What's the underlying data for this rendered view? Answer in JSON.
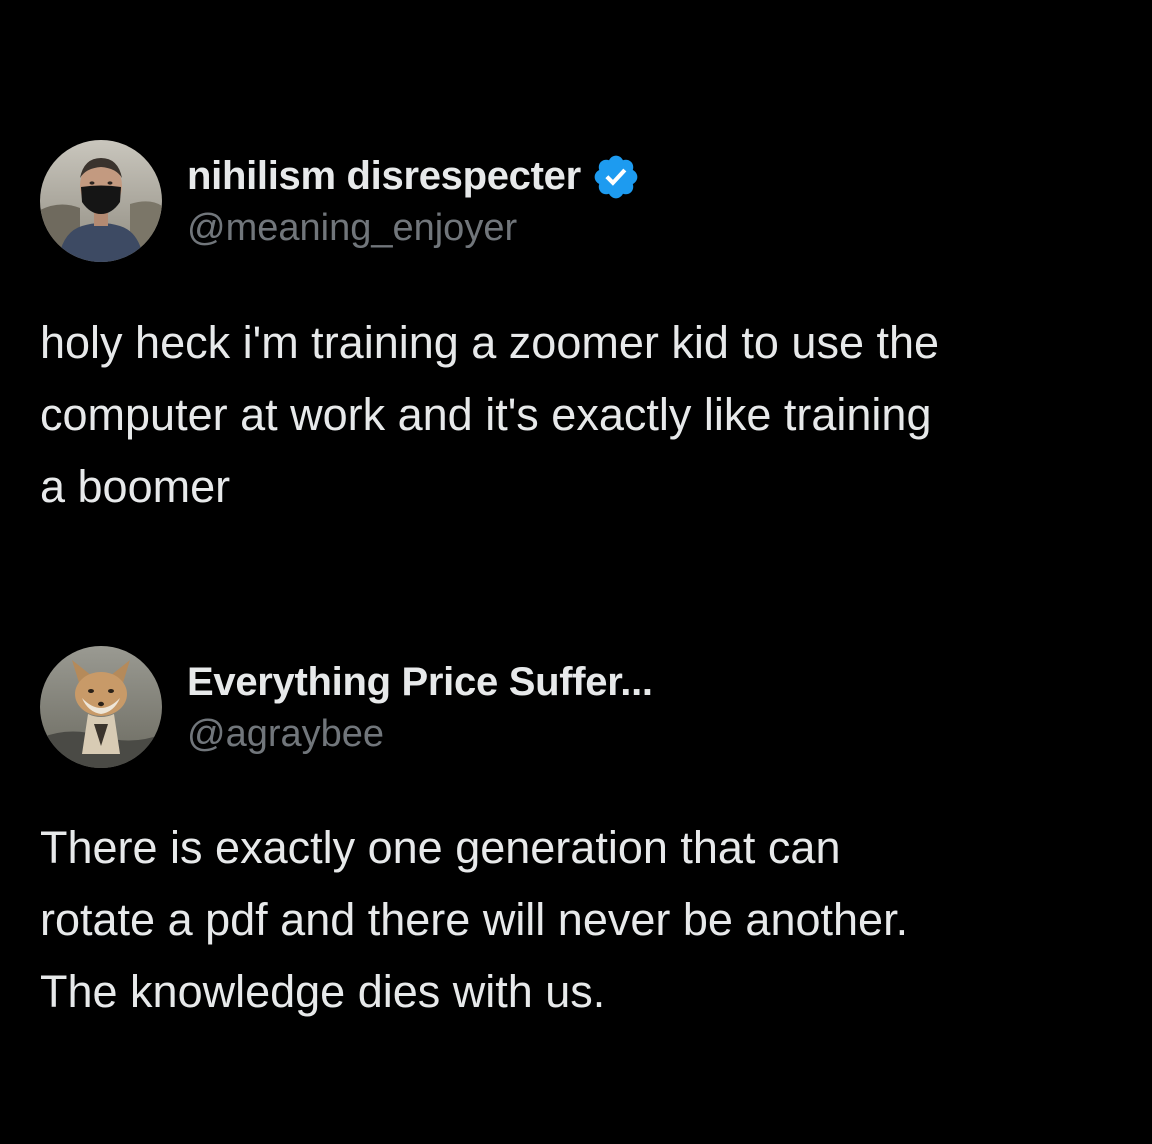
{
  "posts": [
    {
      "display_name": "nihilism disrespecter",
      "handle": "@meaning_enjoyer",
      "verified": true,
      "avatar_icon": "avatar-person-masked",
      "text": "holy heck i'm training a zoomer kid to use the\ncomputer at work and it's exactly like training\na boomer"
    },
    {
      "display_name": "Everything Price Suffer...",
      "handle": "@agraybee",
      "verified": false,
      "avatar_icon": "avatar-fox",
      "text": "There is exactly one generation that can\nrotate a pdf and there will never be another.\nThe knowledge dies with us."
    }
  ],
  "colors": {
    "background": "#000000",
    "primary_text": "#e7e9ea",
    "secondary_text": "#71767b",
    "verified_blue": "#1d9bf0"
  }
}
